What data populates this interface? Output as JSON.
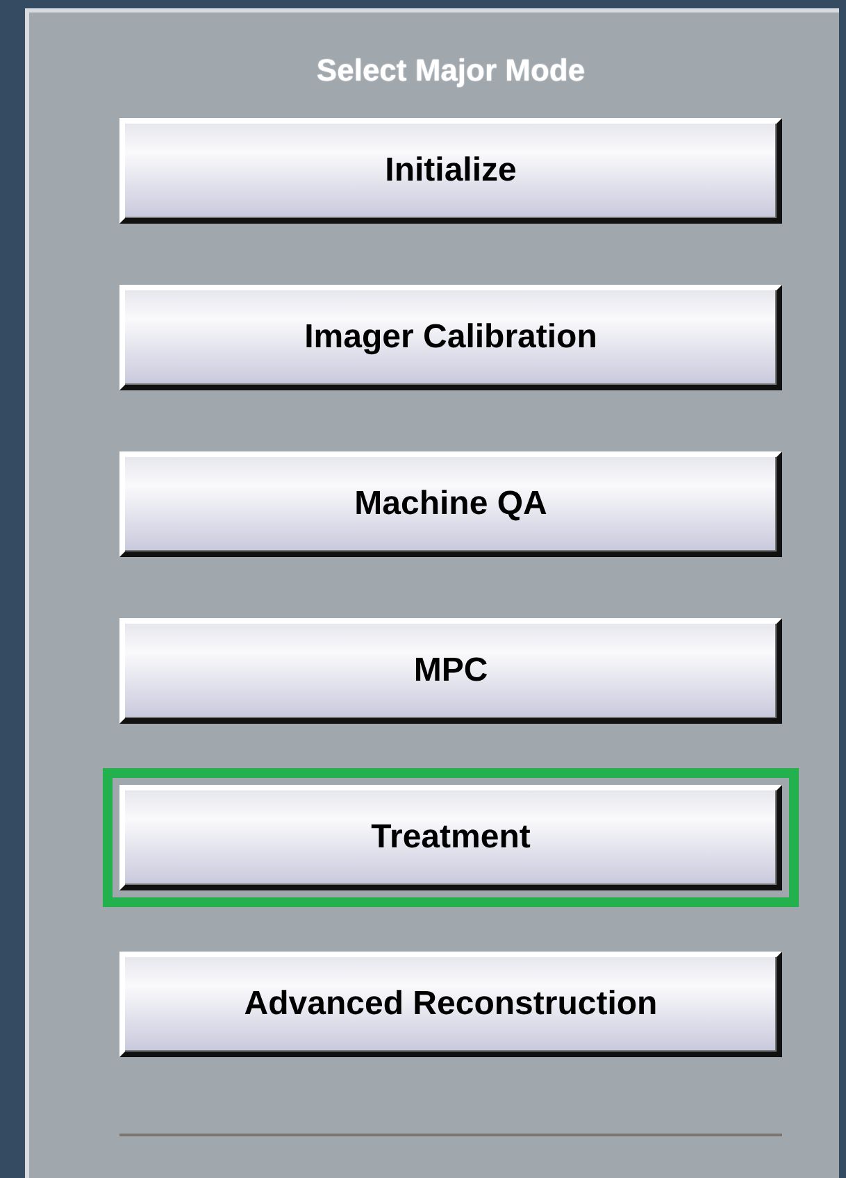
{
  "panel": {
    "title": "Select Major Mode"
  },
  "modes": [
    {
      "label": "Initialize",
      "selected": false
    },
    {
      "label": "Imager Calibration",
      "selected": false
    },
    {
      "label": "Machine QA",
      "selected": false
    },
    {
      "label": "MPC",
      "selected": false
    },
    {
      "label": "Treatment",
      "selected": true
    },
    {
      "label": "Advanced Reconstruction",
      "selected": false
    }
  ]
}
